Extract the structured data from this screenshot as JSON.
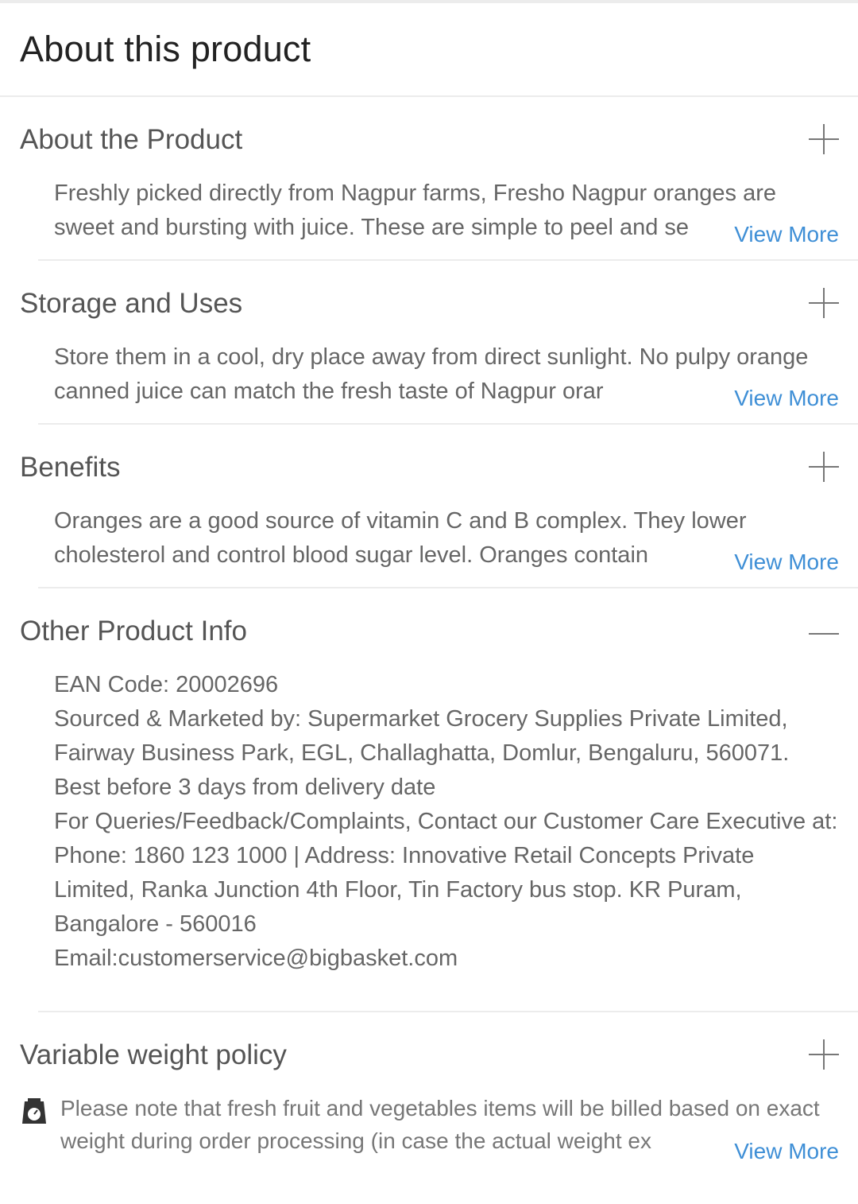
{
  "page": {
    "title": "About this product"
  },
  "sections": [
    {
      "title": "About the Product",
      "state": "collapsed",
      "preview": "Freshly picked directly from Nagpur farms, Fresho Nagpur oranges are sweet and bursting with juice. These are simple to peel and se",
      "view_more": "View More"
    },
    {
      "title": "Storage and Uses",
      "state": "collapsed",
      "preview": "Store them in a cool, dry place away from direct sunlight. No pulpy orange canned juice can match the fresh taste of Nagpur orar",
      "view_more": "View More"
    },
    {
      "title": "Benefits",
      "state": "collapsed",
      "preview": "Oranges are a good source of vitamin C and B complex. They lower cholesterol and control blood sugar level. Oranges contain",
      "view_more": "View More"
    },
    {
      "title": "Other Product Info",
      "state": "expanded",
      "lines": [
        "EAN Code: 20002696",
        "Sourced & Marketed by: Supermarket Grocery Supplies Private Limited, Fairway Business Park, EGL, Challaghatta, Domlur, Bengaluru, 560071.",
        "Best before 3 days from delivery date",
        "For Queries/Feedback/Complaints, Contact our Customer Care Executive at: Phone: 1860 123 1000 | Address: Innovative Retail Concepts Private Limited, Ranka Junction 4th Floor, Tin Factory bus stop. KR Puram, Bangalore - 560016",
        "Email:customerservice@bigbasket.com"
      ]
    },
    {
      "title": "Variable weight policy",
      "state": "collapsed",
      "icon": "weighing-scale-icon",
      "preview": "Please note that fresh fruit and vegetables items will be billed based on exact weight during order processing (in case the actual weight ex",
      "view_more": "View More"
    }
  ],
  "colors": {
    "link": "#3f8fd6",
    "divider": "#ececec",
    "body_text": "#666666"
  }
}
